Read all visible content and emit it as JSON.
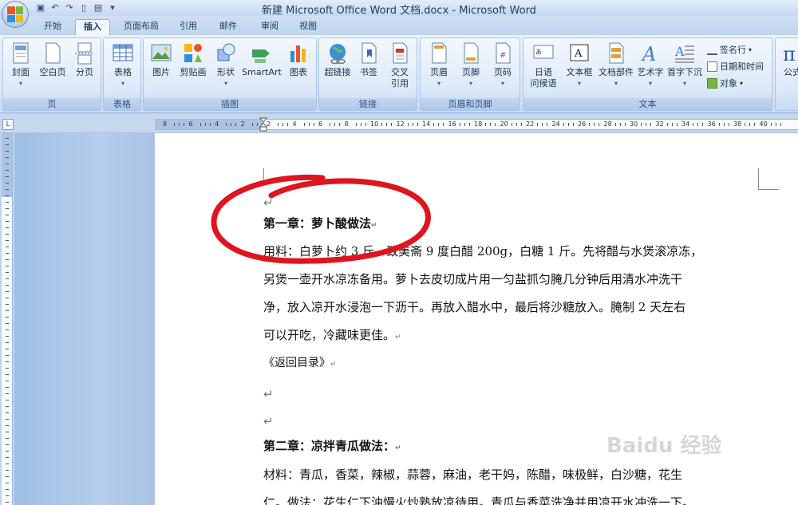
{
  "window": {
    "title": "新建 Microsoft Office Word 文档.docx - Microsoft Word"
  },
  "tabs": [
    {
      "label": "开始",
      "active": false
    },
    {
      "label": "插入",
      "active": true
    },
    {
      "label": "页面布局",
      "active": false
    },
    {
      "label": "引用",
      "active": false
    },
    {
      "label": "邮件",
      "active": false
    },
    {
      "label": "审阅",
      "active": false
    },
    {
      "label": "视图",
      "active": false
    }
  ],
  "ribbon": {
    "groups": {
      "page": {
        "label": "页",
        "buttons": {
          "cover": "封面",
          "blank": "空白页",
          "break": "分页"
        }
      },
      "table": {
        "label": "表格",
        "buttons": {
          "table": "表格"
        }
      },
      "illustrations": {
        "label": "插图",
        "buttons": {
          "picture": "图片",
          "clipart": "剪贴画",
          "shapes": "形状",
          "smartart": "SmartArt",
          "chart": "图表"
        }
      },
      "links": {
        "label": "链接",
        "buttons": {
          "hyperlink": "超链接",
          "bookmark": "书签",
          "crossref_1": "交叉",
          "crossref_2": "引用"
        }
      },
      "header_footer": {
        "label": "页眉和页脚",
        "buttons": {
          "header": "页眉",
          "footer": "页脚",
          "page_number": "页码"
        }
      },
      "text": {
        "label": "文本",
        "buttons": {
          "phonetic_1": "日语",
          "phonetic_2": "问候语",
          "textbox": "文本框",
          "parts": "文档部件",
          "wordart": "艺术字",
          "dropcap": "首字下沉"
        },
        "small": {
          "signature": "签名行",
          "datetime": "日期和时间",
          "object": "对象"
        }
      },
      "symbols": {
        "formula": "公式"
      }
    }
  },
  "ruler": {
    "numbers": [
      "8",
      "6",
      "4",
      "2",
      "2",
      "4",
      "6",
      "8",
      "10",
      "12",
      "14",
      "16",
      "18",
      "20",
      "22",
      "24",
      "26",
      "28",
      "30",
      "32",
      "34",
      "36",
      "38",
      "40"
    ]
  },
  "document": {
    "para_mark": "↵",
    "chapter1_title": "第一章：萝卜酸做法",
    "chapter1_lines": [
      "用料：白萝卜约 3 斤，致美斋 9 度白醋 200g，白糖 1 斤。先将醋与水煲滚凉冻，",
      "另煲一壶开水凉冻备用。萝卜去皮切成片用一匀盐抓匀腌几分钟后用清水冲洗干",
      "净，放入凉开水浸泡一下沥干。再放入醋水中，最后将沙糖放入。腌制 2 天左右",
      "可以开吃，冷藏味更佳。"
    ],
    "back_link": "《返回目录》",
    "chapter2_title": "第二章：凉拌青瓜做法：",
    "chapter2_lines": [
      "材料：青瓜，香菜，辣椒，蒜蓉，麻油，老干妈，陈醋，味极鲜，白沙糖，花生",
      "仁。做法：花生仁下油慢火炒熟放凉待用。青瓜与香菜洗净并用凉开水冲洗一下。"
    ]
  },
  "watermark": "Baidu 经验",
  "colors": {
    "annotation_red": "#e0141e",
    "ribbon_blue": "#dbe8f8"
  }
}
